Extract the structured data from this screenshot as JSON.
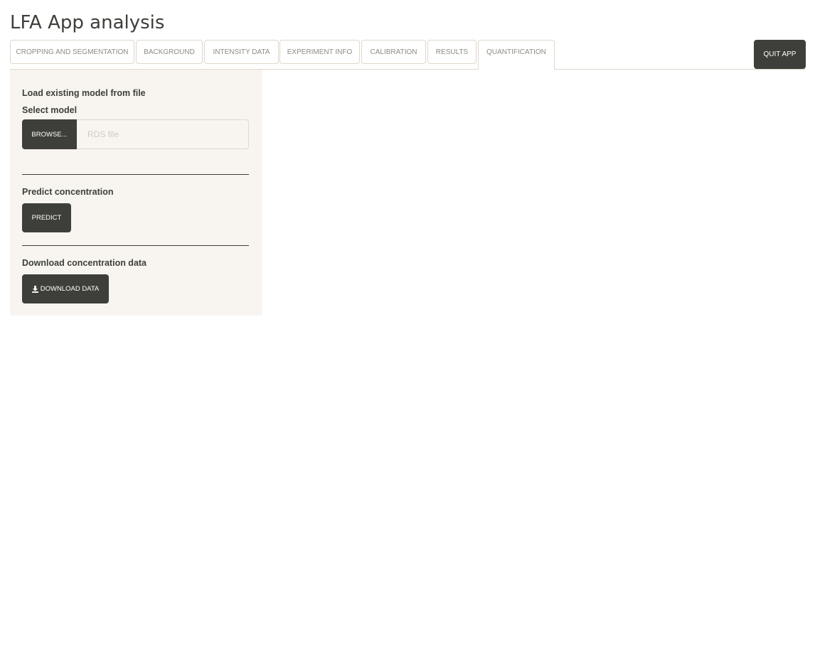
{
  "app": {
    "title": "LFA App analysis"
  },
  "tabs": [
    {
      "label": "Cropping and Segmentation"
    },
    {
      "label": "Background"
    },
    {
      "label": "Intensity data"
    },
    {
      "label": "Experiment info"
    },
    {
      "label": "Calibration"
    },
    {
      "label": "Results"
    },
    {
      "label": "Quantification",
      "active": true
    }
  ],
  "header": {
    "quit_label": "Quit app"
  },
  "sidebar": {
    "load_model_heading": "Load existing model from file",
    "select_model_label": "Select model",
    "browse_label": "Browse...",
    "file_placeholder": "RDS file",
    "file_value": "",
    "predict_heading": "Predict concentration",
    "predict_label": "Predict",
    "download_heading": "Download concentration data",
    "download_label": "Download data",
    "download_icon": "download-icon"
  },
  "colors": {
    "primary_dark": "#3e3f3a",
    "panel_bg": "#f8f5f0",
    "border": "#dfd7ca",
    "tab_text": "#8e8c84"
  }
}
